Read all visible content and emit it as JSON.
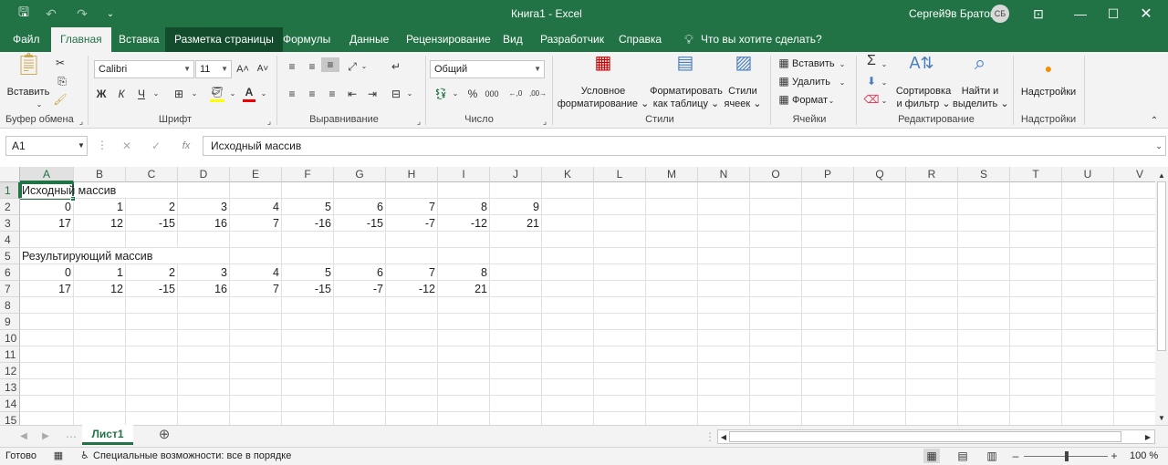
{
  "titlebar": {
    "title": "Книга1  -  Excel",
    "user": "Сергей9в Братов",
    "avatar": "СБ"
  },
  "tabs": [
    "Файл",
    "Главная",
    "Вставка",
    "Разметка страницы",
    "Формулы",
    "Данные",
    "Рецензирование",
    "Вид",
    "Разработчик",
    "Справка",
    "Что вы хотите сделать?"
  ],
  "ribbon": {
    "paste": "Вставить",
    "font_name": "Calibri",
    "font_size": "11",
    "bold": "Ж",
    "italic": "К",
    "underline": "Ч",
    "number_format": "Общий",
    "cond_format_1": "Условное",
    "cond_format_2": "форматирование",
    "format_table_1": "Форматировать",
    "format_table_2": "как таблицу",
    "cell_styles_1": "Стили",
    "cell_styles_2": "ячеек",
    "insert": "Вставить",
    "delete": "Удалить",
    "format": "Формат",
    "sort_1": "Сортировка",
    "sort_2": "и фильтр",
    "find_1": "Найти и",
    "find_2": "выделить",
    "addins": "Надстройки",
    "groups": {
      "clipboard": "Буфер обмена",
      "font": "Шрифт",
      "align": "Выравнивание",
      "number": "Число",
      "styles": "Стили",
      "cells": "Ячейки",
      "editing": "Редактирование",
      "addins": "Надстройки"
    }
  },
  "formula_bar": {
    "name_box": "A1",
    "content": "Исходный массив",
    "fx": "fx"
  },
  "grid": {
    "columns": [
      "A",
      "B",
      "C",
      "D",
      "E",
      "F",
      "G",
      "H",
      "I",
      "J",
      "K",
      "L",
      "M",
      "N",
      "O",
      "P",
      "Q",
      "R",
      "S",
      "T",
      "U",
      "V"
    ],
    "rows": [
      "1",
      "2",
      "3",
      "4",
      "5",
      "6",
      "7",
      "8",
      "9",
      "10",
      "11",
      "12",
      "13",
      "14",
      "15"
    ],
    "cells": {
      "r1_a": "Исходный массив",
      "r2": [
        "0",
        "1",
        "2",
        "3",
        "4",
        "5",
        "6",
        "7",
        "8",
        "9"
      ],
      "r3": [
        "17",
        "12",
        "-15",
        "16",
        "7",
        "-16",
        "-15",
        "-7",
        "-12",
        "21"
      ],
      "r5_a": "Результирующий массив",
      "r6": [
        "0",
        "1",
        "2",
        "3",
        "4",
        "5",
        "6",
        "7",
        "8"
      ],
      "r7": [
        "17",
        "12",
        "-15",
        "16",
        "7",
        "-15",
        "-7",
        "-12",
        "21"
      ]
    }
  },
  "sheet_tab": "Лист1",
  "status": {
    "ready": "Готово",
    "accessibility": "Специальные возможности: все в порядке",
    "zoom": "100 %"
  }
}
